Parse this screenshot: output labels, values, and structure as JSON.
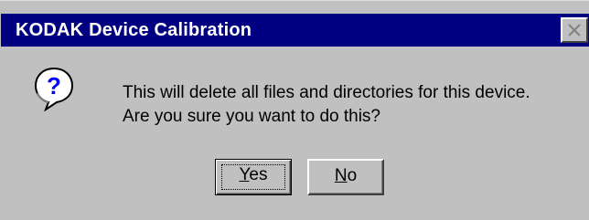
{
  "window": {
    "title": "KODAK Device Calibration",
    "close_icon": "close-icon"
  },
  "message": {
    "icon": "question-icon",
    "line1": "This will delete all files and directories for this device.",
    "line2": "Are you sure you want to do this?"
  },
  "buttons": {
    "yes_mnemonic": "Y",
    "yes_rest": "es",
    "no_mnemonic": "N",
    "no_rest": "o"
  },
  "colors": {
    "titlebar": "#000080",
    "dialog_face": "#c0c0c0",
    "icon_blue": "#0000ff"
  }
}
